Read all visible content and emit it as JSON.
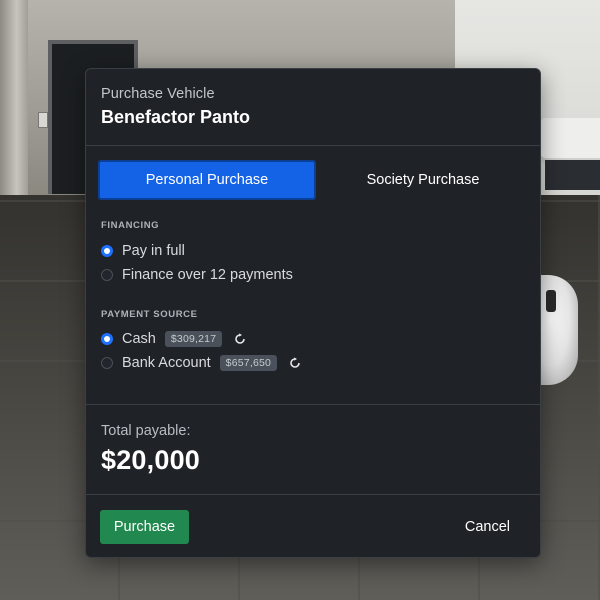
{
  "dialog": {
    "subtitle": "Purchase Vehicle",
    "vehicle_name": "Benefactor Panto"
  },
  "tabs": [
    {
      "label": "Personal Purchase",
      "active": true
    },
    {
      "label": "Society Purchase",
      "active": false
    }
  ],
  "financing": {
    "label": "FINANCING",
    "options": [
      {
        "label": "Pay in full",
        "selected": true
      },
      {
        "label": "Finance over 12 payments",
        "selected": false
      }
    ]
  },
  "payment_source": {
    "label": "PAYMENT SOURCE",
    "options": [
      {
        "label": "Cash",
        "balance": "$309,217",
        "selected": true,
        "icon": "refresh-icon"
      },
      {
        "label": "Bank Account",
        "balance": "$657,650",
        "selected": false,
        "icon": "refresh-icon"
      }
    ]
  },
  "total": {
    "label": "Total payable:",
    "amount": "$20,000"
  },
  "actions": {
    "purchase_label": "Purchase",
    "cancel_label": "Cancel"
  },
  "colors": {
    "accent": "#1463e6",
    "purchase": "#21894f",
    "panel": "#1f2227"
  }
}
